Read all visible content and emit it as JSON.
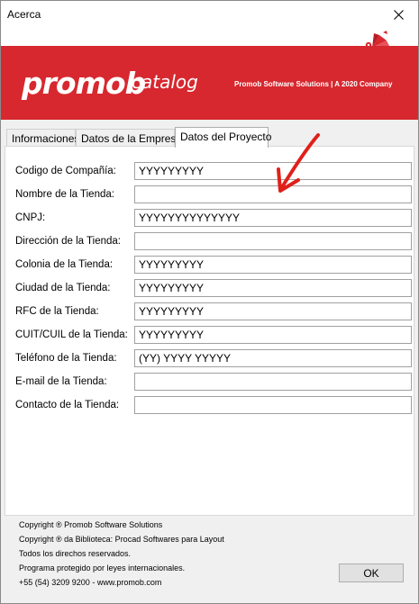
{
  "window": {
    "title": "Acerca"
  },
  "banner": {
    "logo_main": "promob",
    "logo_sub": "catalog",
    "tagline": "Promob Software Solutions | A 2020 Company"
  },
  "tabs": [
    {
      "label": "Informaciones",
      "active": false
    },
    {
      "label": "Datos de la Empresa",
      "active": false
    },
    {
      "label": "Datos del Proyecto",
      "active": true
    }
  ],
  "fields": [
    {
      "label": "Codigo de Compañía:",
      "value": "YYYYYYYYY"
    },
    {
      "label": "Nombre de la Tienda:",
      "value": ""
    },
    {
      "label": "CNPJ:",
      "value": "YYYYYYYYYYYYYY"
    },
    {
      "label": "Dirección de la Tienda:",
      "value": ""
    },
    {
      "label": "Colonia de la Tienda:",
      "value": "YYYYYYYYY"
    },
    {
      "label": "Ciudad de la Tienda:",
      "value": "YYYYYYYYY"
    },
    {
      "label": "RFC de la Tienda:",
      "value": "YYYYYYYYY"
    },
    {
      "label": "CUIT/CUIL de la Tienda:",
      "value": "YYYYYYYYY"
    },
    {
      "label": "Teléfono de la Tienda:",
      "value": "(YY) YYYY YYYYY"
    },
    {
      "label": "E-mail de la Tienda:",
      "value": ""
    },
    {
      "label": "Contacto de la Tienda:",
      "value": ""
    }
  ],
  "footer": {
    "lines": [
      "Copyright ® Promob Software Solutions",
      "Copyright ® da Biblioteca: Procad Softwares para Layout",
      "Todos los direchos reservados.",
      "Programa protegido por leyes internacionales.",
      "+55 (54) 3209 9200  -  www.promob.com"
    ],
    "ok_label": "OK"
  },
  "colors": {
    "brand_red": "#d7282f",
    "annotation_arrow": "#e0201b"
  },
  "icons": {
    "close": "close-icon",
    "corner": "promob-fan-icon",
    "annotation": "red-arrow-icon"
  }
}
